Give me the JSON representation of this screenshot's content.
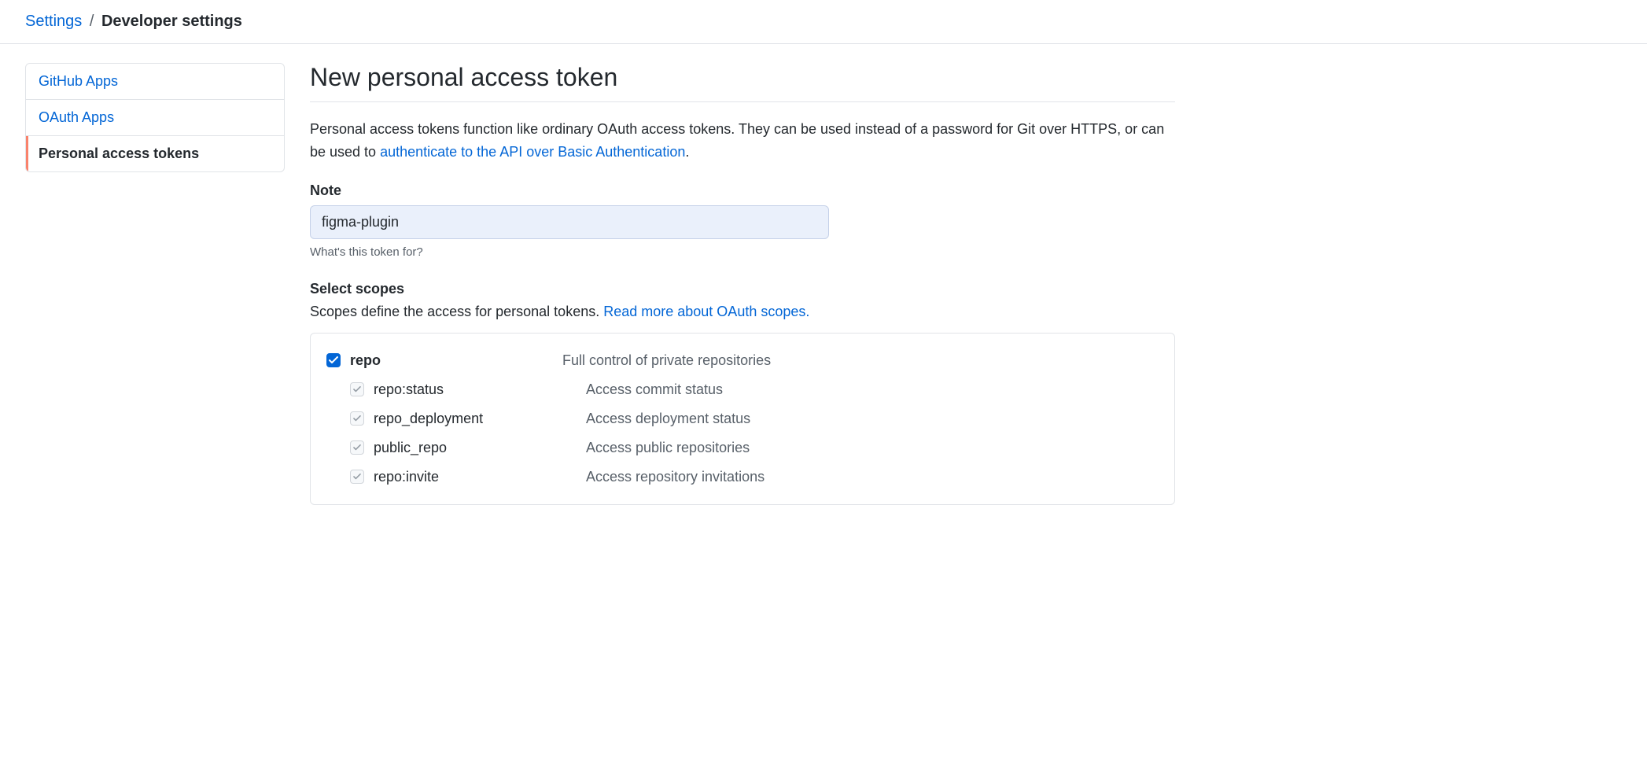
{
  "breadcrumb": {
    "settings": "Settings",
    "separator": "/",
    "current": "Developer settings"
  },
  "sidebar": {
    "items": [
      {
        "label": "GitHub Apps"
      },
      {
        "label": "OAuth Apps"
      },
      {
        "label": "Personal access tokens"
      }
    ]
  },
  "main": {
    "title": "New personal access token",
    "intro_before": "Personal access tokens function like ordinary OAuth access tokens. They can be used instead of a password for Git over HTTPS, or can be used to ",
    "intro_link": "authenticate to the API over Basic Authentication",
    "intro_after": ".",
    "note_label": "Note",
    "note_value": "figma-plugin",
    "note_hint": "What's this token for?",
    "scopes_label": "Select scopes",
    "scopes_intro_before": "Scopes define the access for personal tokens. ",
    "scopes_intro_link": "Read more about OAuth scopes.",
    "scopes": {
      "parent": {
        "name": "repo",
        "desc": "Full control of private repositories"
      },
      "children": [
        {
          "name": "repo:status",
          "desc": "Access commit status"
        },
        {
          "name": "repo_deployment",
          "desc": "Access deployment status"
        },
        {
          "name": "public_repo",
          "desc": "Access public repositories"
        },
        {
          "name": "repo:invite",
          "desc": "Access repository invitations"
        }
      ]
    }
  }
}
